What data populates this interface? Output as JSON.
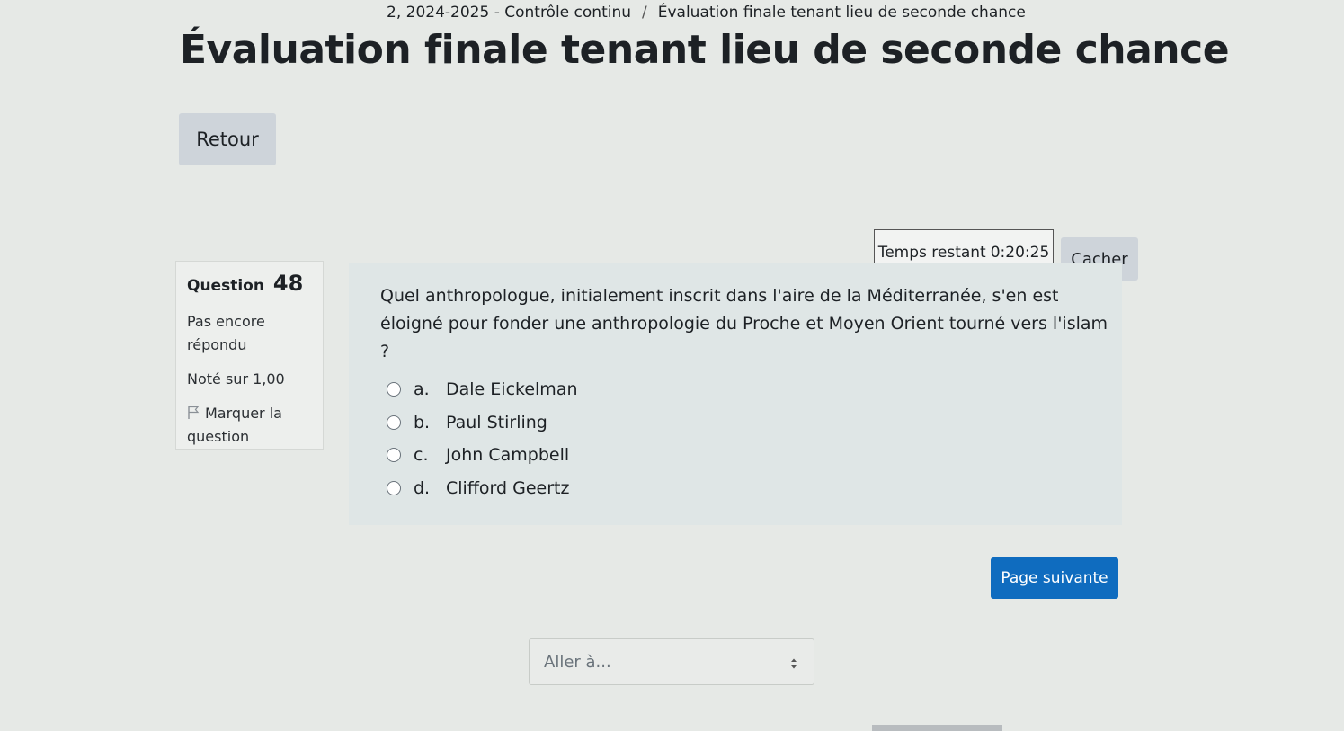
{
  "breadcrumb": {
    "items": [
      "2, 2024-2025 - Contrôle continu",
      "Évaluation finale tenant lieu de seconde chance"
    ],
    "separator": "/"
  },
  "page_title": "Évaluation finale tenant lieu de seconde chance",
  "back_button": "Retour",
  "timer": {
    "label": "Temps restant",
    "value": "0:20:25",
    "hide_button": "Cacher"
  },
  "question_info": {
    "label": "Question",
    "number": "48",
    "status_line1": "Pas encore",
    "status_line2": "répondu",
    "grade": "Noté sur 1,00",
    "flag_line1": "Marquer la",
    "flag_line2": "question",
    "flag_icon": "flag-icon"
  },
  "question": {
    "text": "Quel anthropologue, initialement inscrit dans l'aire de la Méditerranée, s'en est éloigné pour fonder une anthropologie du Proche et Moyen Orient tourné vers l'islam ?",
    "answers": [
      {
        "letter": "a.",
        "text": "Dale Eickelman"
      },
      {
        "letter": "b.",
        "text": "Paul Stirling"
      },
      {
        "letter": "c.",
        "text": "John Campbell"
      },
      {
        "letter": "d.",
        "text": "Clifford Geertz"
      }
    ]
  },
  "next_button": "Page suivante",
  "jump_select": {
    "placeholder": "Aller à..."
  },
  "colors": {
    "primary": "#0f6cbf",
    "background": "#e6e9e6",
    "content_bg": "#dfe6e6",
    "secondary_btn": "#ced4da"
  }
}
